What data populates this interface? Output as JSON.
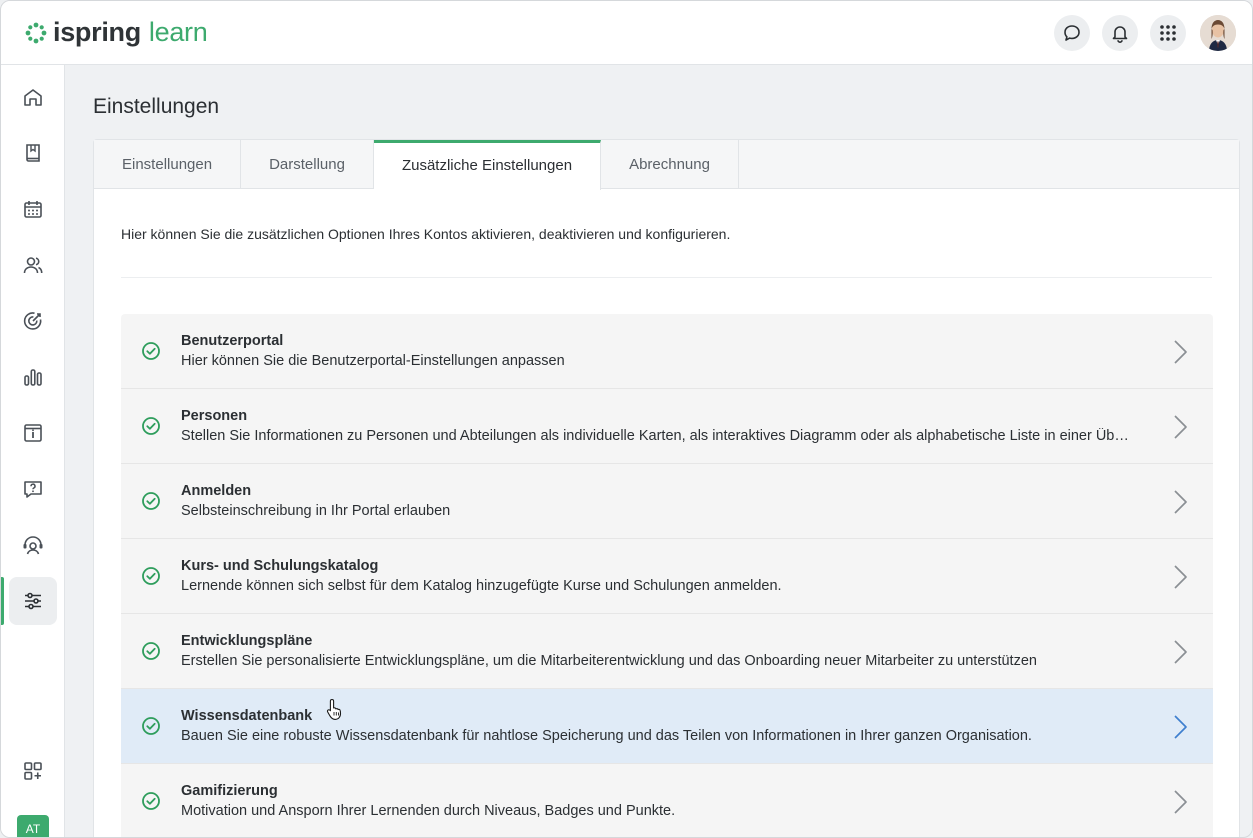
{
  "brand": {
    "word1": "ispring",
    "word2": "learn",
    "accent": "#3daa6e"
  },
  "header": {
    "icons": [
      "chat-icon",
      "bell-icon",
      "apps-grid-icon"
    ],
    "avatar": "user-avatar"
  },
  "sidebar": {
    "items": [
      {
        "icon": "home-icon"
      },
      {
        "icon": "book-icon"
      },
      {
        "icon": "calendar-icon"
      },
      {
        "icon": "users-icon"
      },
      {
        "icon": "target-icon"
      },
      {
        "icon": "bar-chart-icon"
      },
      {
        "icon": "info-box-icon"
      },
      {
        "icon": "question-chat-icon"
      },
      {
        "icon": "support-agent-icon"
      },
      {
        "icon": "sliders-icon",
        "active": true
      }
    ],
    "add_widget_icon": "add-grid-icon",
    "user_badge": "AT"
  },
  "page": {
    "title": "Einstellungen",
    "tabs": [
      {
        "label": "Einstellungen"
      },
      {
        "label": "Darstellung"
      },
      {
        "label": "Zusätzliche Einstellungen",
        "active": true
      },
      {
        "label": "Abrechnung"
      }
    ],
    "intro": "Hier können Sie die zusätzlichen Optionen Ihres Kontos aktivieren, deaktivieren und konfigurieren.",
    "options": [
      {
        "title": "Benutzerportal",
        "desc": "Hier können Sie die Benutzerportal-Einstellungen anpassen"
      },
      {
        "title": "Personen",
        "desc": "Stellen Sie Informationen zu Personen und Abteilungen als individuelle Karten, als interaktives Diagramm oder als alphabetische Liste in einer Übersicht dar"
      },
      {
        "title": "Anmelden",
        "desc": "Selbsteinschreibung in Ihr Portal erlauben"
      },
      {
        "title": "Kurs- und Schulungskatalog",
        "desc": "Lernende können sich selbst für dem Katalog hinzugefügte Kurse und Schulungen anmelden."
      },
      {
        "title": "Entwicklungspläne",
        "desc": "Erstellen Sie personalisierte Entwicklungspläne, um die Mitarbeiterentwicklung und das Onboarding neuer Mitarbeiter zu unterstützen"
      },
      {
        "title": "Wissensdatenbank",
        "desc": "Bauen Sie eine robuste Wissensdatenbank für nahtlose Speicherung und das Teilen von Informationen in Ihrer ganzen Organisation.",
        "hover": true
      },
      {
        "title": "Gamifizierung",
        "desc": "Motivation und Ansporn Ihrer Lernenden durch Niveaus, Badges und Punkte."
      }
    ]
  }
}
